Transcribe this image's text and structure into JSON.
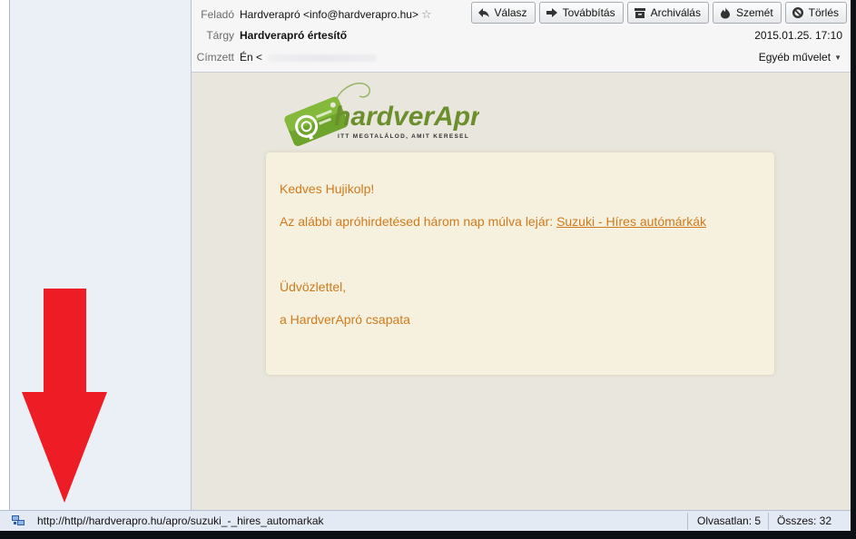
{
  "header": {
    "from_label": "Feladó",
    "from_value": "Hardverapró <info@hardverapro.hu>",
    "subject_label": "Tárgy",
    "subject_value": "Hardverapró értesítő",
    "to_label": "Címzett",
    "to_value": "Én <",
    "date": "2015.01.25. 17:10",
    "more_actions": "Egyéb művelet"
  },
  "toolbar": {
    "reply": "Válasz",
    "forward": "Továbbítás",
    "archive": "Archiválás",
    "junk": "Szemét",
    "delete": "Törlés"
  },
  "logo": {
    "brand": "hardverApró",
    "tagline": "ITT MEGTALÁLOD, AMIT KERESEL"
  },
  "message": {
    "greeting": "Kedves Hujikolp!",
    "notice": "Az alábbi apróhirdetésed három nap múlva lejár:",
    "ad_link": "Suzuki - Híres autómárkák",
    "closing": "Üdvözlettel,",
    "signature": "a HardverApró csapata"
  },
  "statusbar": {
    "url": "http://http//hardverapro.hu/apro/suzuki_-_hires_automarkak",
    "unread": "Olvasatlan: 5",
    "total": "Összes: 32"
  },
  "colors": {
    "accent_text": "#d07a1e",
    "body_bg": "#e9e6dd",
    "card_bg": "#f6f1de",
    "arrow": "#ee1c25",
    "logo_green": "#6fa42c"
  }
}
